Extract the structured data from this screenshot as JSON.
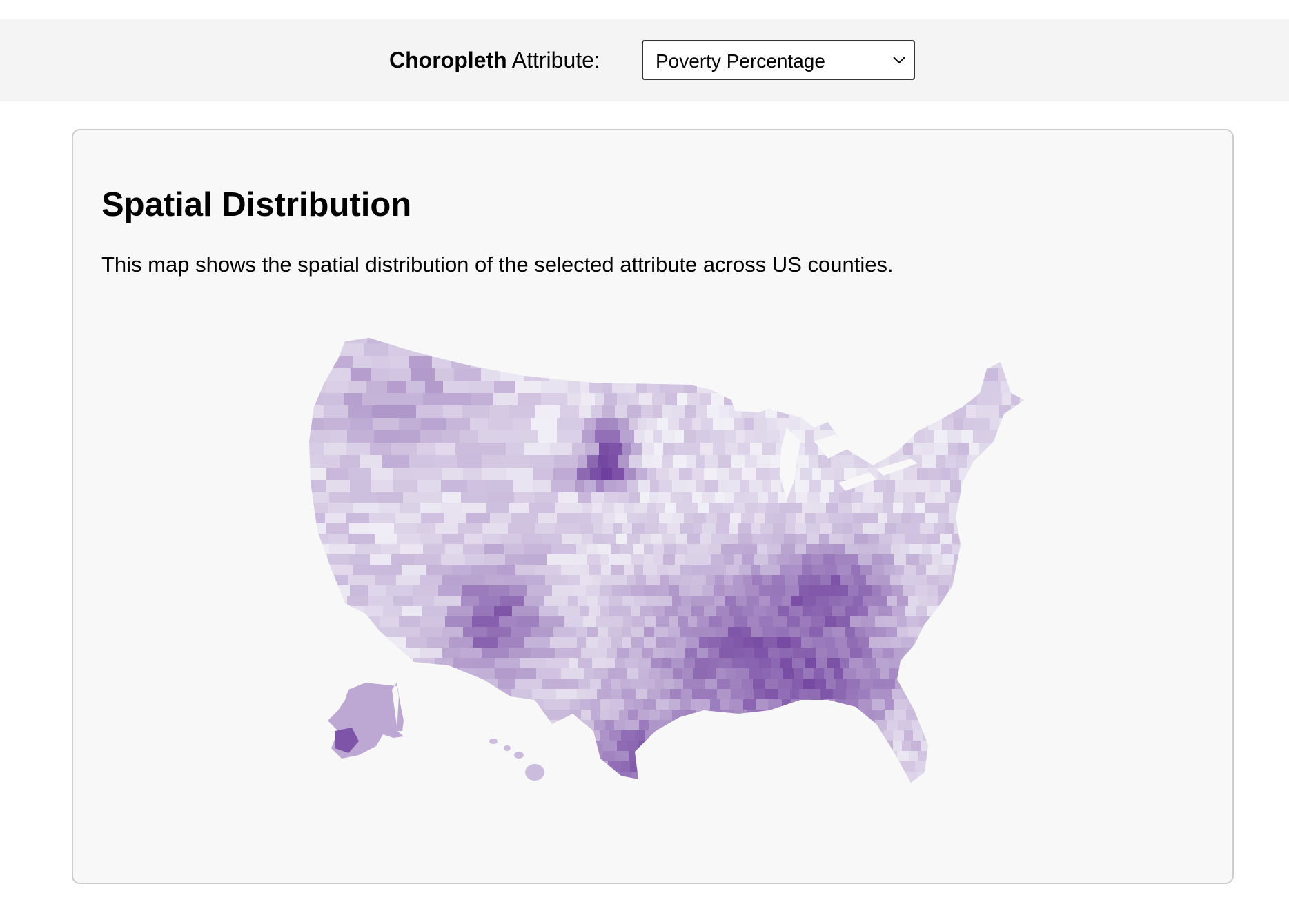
{
  "controls": {
    "label_bold": "Choropleth",
    "label_rest": " Attribute:",
    "selected_attribute": "Poverty Percentage"
  },
  "card": {
    "title": "Spatial Distribution",
    "description": "This map shows the spatial distribution of the selected attribute across US counties."
  },
  "map": {
    "type": "choropleth",
    "geography": "US counties",
    "attribute": "Poverty Percentage",
    "color_scale": "Purples",
    "colors": {
      "low": "#f2f0f7",
      "high": "#3f007d"
    }
  }
}
